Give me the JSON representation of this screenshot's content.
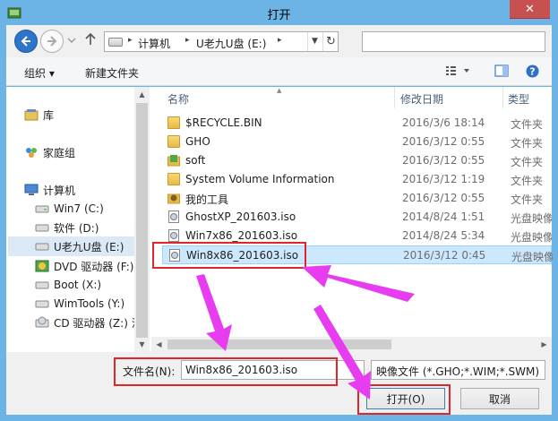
{
  "window": {
    "title": "打开",
    "close_glyph": "✕"
  },
  "address": {
    "crumbs": [
      "计算机",
      "U老九U盘 (E:)"
    ],
    "sep": "▸",
    "search_placeholder": ""
  },
  "toolbar": {
    "organize": "组织 ▾",
    "new_folder": "新建文件夹"
  },
  "nav": {
    "items": [
      {
        "label": "库",
        "icon": "library-icon"
      },
      {
        "label": "家庭组",
        "icon": "homegroup-icon"
      },
      {
        "label": "计算机",
        "icon": "computer-icon"
      },
      {
        "label": "Win7 (C:)",
        "icon": "drive-icon"
      },
      {
        "label": "软件 (D:)",
        "icon": "drive-icon"
      },
      {
        "label": "U老九U盘 (E:)",
        "icon": "drive-icon"
      },
      {
        "label": "DVD 驱动器 (F:)",
        "icon": "dvd-icon"
      },
      {
        "label": "Boot (X:)",
        "icon": "drive-icon"
      },
      {
        "label": "WimTools (Y:)",
        "icon": "drive-icon"
      },
      {
        "label": "CD 驱动器 (Z:) 泪",
        "icon": "cd-icon"
      }
    ]
  },
  "columns": {
    "name": "名称",
    "date": "修改日期",
    "type": "类型"
  },
  "files": [
    {
      "name": "$RECYCLE.BIN",
      "date": "2016/3/6 18:14",
      "type": "文件夹",
      "icon": "folder-icon"
    },
    {
      "name": "GHO",
      "date": "2016/3/12 0:55",
      "type": "文件夹",
      "icon": "folder-icon"
    },
    {
      "name": "soft",
      "date": "2016/3/12 0:55",
      "type": "文件夹",
      "icon": "folder-green-icon"
    },
    {
      "name": "System Volume Information",
      "date": "2016/3/12 1:19",
      "type": "文件夹",
      "icon": "folder-icon"
    },
    {
      "name": "我的工具",
      "date": "2016/3/12 0:55",
      "type": "文件夹",
      "icon": "folder-tools-icon"
    },
    {
      "name": "GhostXP_201603.iso",
      "date": "2014/8/24 1:51",
      "type": "光盘映像文件",
      "icon": "iso-icon"
    },
    {
      "name": "Win7x86_201603.iso",
      "date": "2014/8/24 5:34",
      "type": "光盘映像文件",
      "icon": "iso-icon"
    },
    {
      "name": "Win8x86_201603.iso",
      "date": "2016/3/12 0:45",
      "type": "光盘映像文件",
      "icon": "iso-icon"
    }
  ],
  "bottom": {
    "filename_label": "文件名(N):",
    "filename_value": "Win8x86_201603.iso",
    "filetype_value": "映像文件 (*.GHO;*.WIM;*.SWM)",
    "open_label": "打开(O)",
    "cancel_label": "取消"
  },
  "colors": {
    "highlight": "#e0262b",
    "arrow": "#e83cf0",
    "selection": "#cce8ff"
  }
}
